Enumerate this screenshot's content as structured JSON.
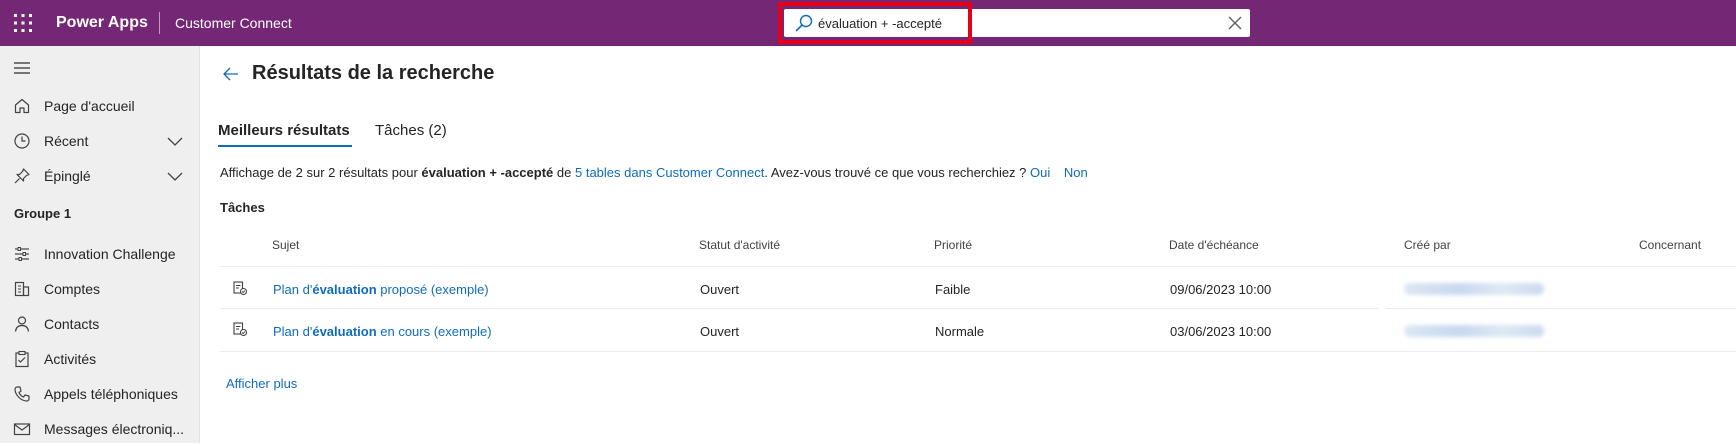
{
  "header": {
    "app_name": "Power Apps",
    "environment": "Customer Connect",
    "search_value": "évaluation + -accepté",
    "brand_color": "#742774",
    "highlight_color": "#e3001b"
  },
  "sidebar": {
    "items": [
      {
        "label": "Page d'accueil",
        "icon": "home-icon"
      },
      {
        "label": "Récent",
        "icon": "clock-icon",
        "expandable": true
      },
      {
        "label": "Épinglé",
        "icon": "pin-icon",
        "expandable": true
      }
    ],
    "group_label": "Groupe 1",
    "group_items": [
      {
        "label": "Innovation Challenge",
        "icon": "sliders-icon"
      },
      {
        "label": "Comptes",
        "icon": "building-icon"
      },
      {
        "label": "Contacts",
        "icon": "person-icon"
      },
      {
        "label": "Activités",
        "icon": "clipboard-icon"
      },
      {
        "label": "Appels téléphoniques",
        "icon": "phone-icon"
      },
      {
        "label": "Messages électroniq...",
        "icon": "mail-icon"
      }
    ]
  },
  "main": {
    "title": "Résultats de la recherche",
    "tabs": [
      {
        "label": "Meilleurs résultats",
        "active": true
      },
      {
        "label": "Tâches (2)",
        "active": false
      }
    ],
    "summary": {
      "prefix": "Affichage de 2 sur 2 résultats pour",
      "query": "évaluation + -accepté",
      "mid": "de",
      "tables_link": "5 tables dans Customer Connect",
      "question": ". Avez-vous trouvé ce que vous recherchiez ?",
      "yes": "Oui",
      "no": "Non"
    },
    "section_title": "Tâches",
    "columns": [
      "Sujet",
      "Statut d'activité",
      "Priorité",
      "Date d'échéance",
      "Créé par",
      "Concernant"
    ],
    "rows": [
      {
        "subject_pre": "Plan d'",
        "subject_bold": "évaluation",
        "subject_post": " proposé (exemple)",
        "status": "Ouvert",
        "priority": "Faible",
        "due": "09/06/2023 10:00"
      },
      {
        "subject_pre": "Plan d'",
        "subject_bold": "évaluation",
        "subject_post": " en cours (exemple)",
        "status": "Ouvert",
        "priority": "Normale",
        "due": "03/06/2023 10:00"
      }
    ],
    "show_more": "Afficher plus",
    "link_color": "#0f6cbd"
  }
}
